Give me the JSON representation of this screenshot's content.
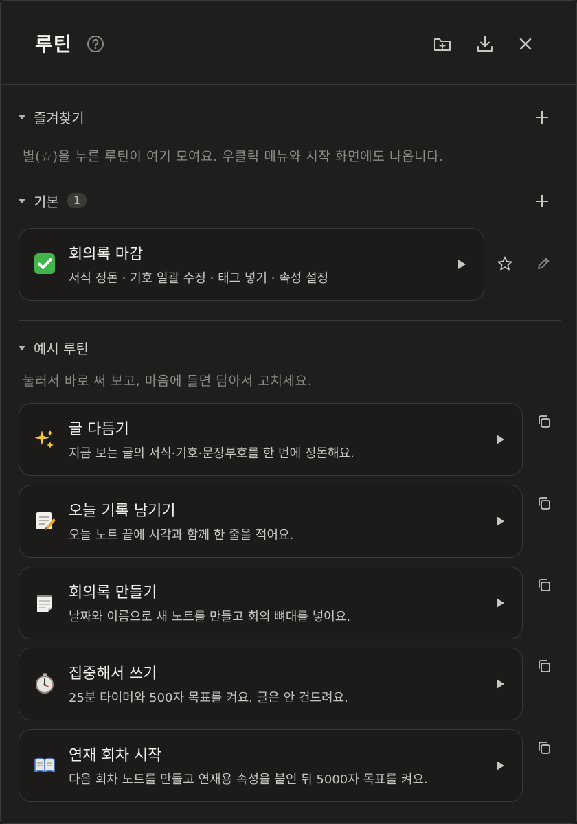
{
  "header": {
    "title": "루틴"
  },
  "favorites": {
    "title": "즐겨찾기",
    "hint": "별(☆)을 누른 루틴이 여기 모여요. 우클릭 메뉴와 시작 화면에도 나옵니다."
  },
  "basic": {
    "title": "기본",
    "count": "1",
    "items": [
      {
        "emoji": "✅",
        "title": "회의록 마감",
        "desc": "서식 정돈 · 기호 일괄 수정 · 태그 넣기 · 속성 설정"
      }
    ]
  },
  "examples": {
    "title": "예시 루틴",
    "hint": "눌러서 바로 써 보고, 마음에 들면 담아서 고치세요.",
    "items": [
      {
        "emoji": "✨",
        "title": "글 다듬기",
        "desc": "지금 보는 글의 서식·기호·문장부호를 한 번에 정돈해요."
      },
      {
        "emoji": "📝",
        "title": "오늘 기록 남기기",
        "desc": "오늘 노트 끝에 시각과 함께 한 줄을 적어요."
      },
      {
        "emoji": "🗒️",
        "title": "회의록 만들기",
        "desc": "날짜와 이름으로 새 노트를 만들고 회의 뼈대를 넣어요."
      },
      {
        "emoji": "⏱️",
        "title": "집중해서 쓰기",
        "desc": "25분 타이머와 500자 목표를 켜요. 글은 안 건드려요."
      },
      {
        "emoji": "📖",
        "title": "연재 회차 시작",
        "desc": "다음 회차 노트를 만들고 연재용 속성을 붙인 뒤 5000자 목표를 켜요."
      }
    ]
  }
}
